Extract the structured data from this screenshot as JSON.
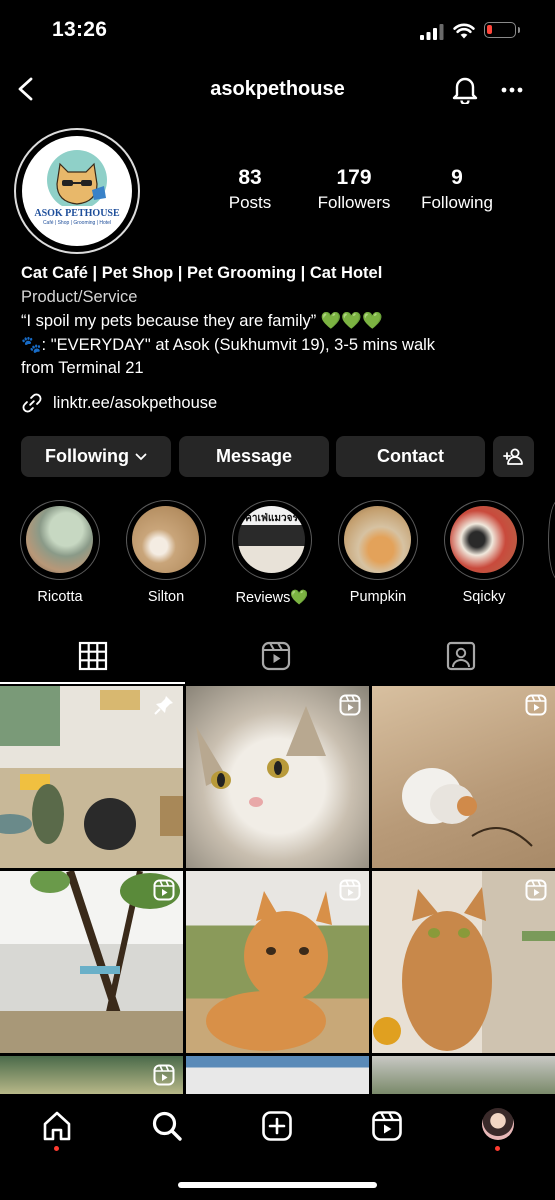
{
  "status_bar": {
    "time": "13:26"
  },
  "header": {
    "username": "asokpethouse"
  },
  "avatar": {
    "brand": "ASOK PETHOUSE",
    "tagline": "Café | Shop | Grooming | Hotel"
  },
  "stats": [
    {
      "value": "83",
      "label": "Posts"
    },
    {
      "value": "179",
      "label": "Followers"
    },
    {
      "value": "9",
      "label": "Following"
    }
  ],
  "bio": {
    "title": "Cat Café | Pet Shop | Pet Grooming | Cat Hotel",
    "category": "Product/Service",
    "quote": "“I spoil my pets because they are family” 💚💚💚",
    "location_line1": "🐾: \"EVERYDAY\" at Asok (Sukhumvit 19), 3-5 mins walk",
    "location_line2": "from Terminal 21",
    "link": "linktr.ee/asokpethouse"
  },
  "actions": {
    "following": "Following",
    "message": "Message",
    "contact": "Contact"
  },
  "highlights": [
    {
      "label": "Ricotta"
    },
    {
      "label": "Silton"
    },
    {
      "label": "Reviews💚",
      "overlay": "คาเฟ่แมวจร"
    },
    {
      "label": "Pumpkin"
    },
    {
      "label": "Sqicky"
    }
  ],
  "colors": {
    "background": "#000000",
    "button": "#262626",
    "accent": "#ff3b30"
  }
}
